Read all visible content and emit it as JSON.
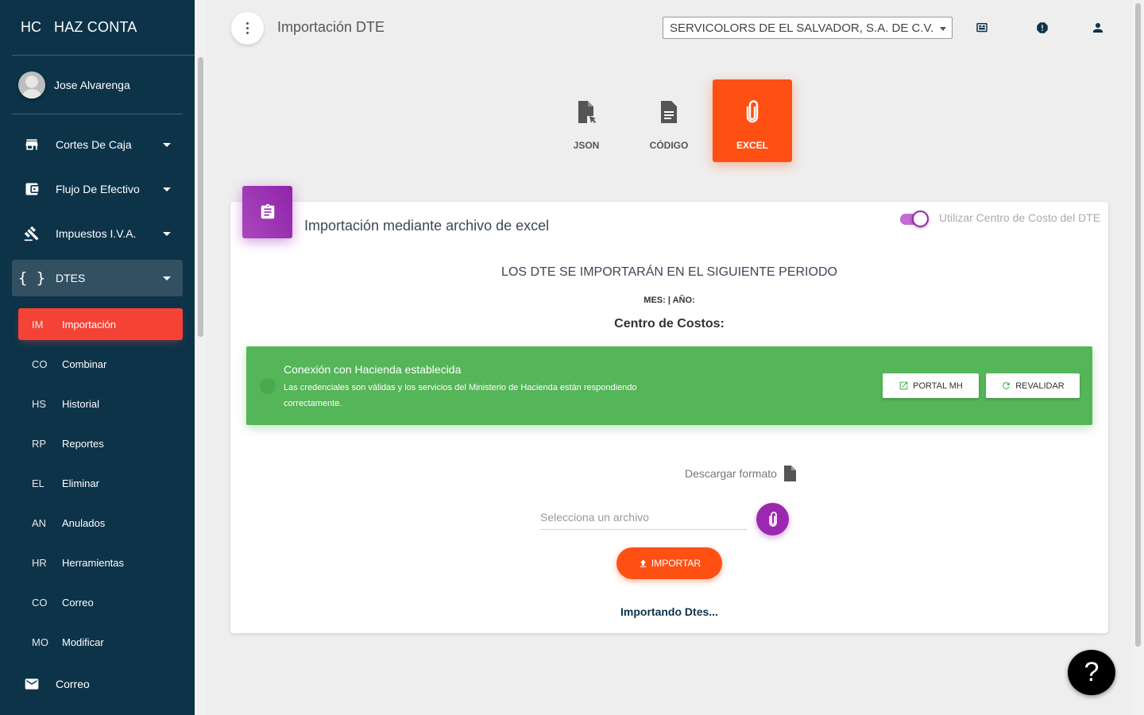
{
  "app": {
    "mini": "HC",
    "name": "HAZ CONTA"
  },
  "user": {
    "name": "Jose Alvarenga"
  },
  "nav": {
    "items": [
      {
        "label": "Cortes De Caja",
        "icon": "store-icon"
      },
      {
        "label": "Flujo De Efectivo",
        "icon": "wallet-icon"
      },
      {
        "label": "Impuestos I.V.A.",
        "icon": "gavel-icon"
      },
      {
        "label": "DTES",
        "icon": "code-braces-icon"
      }
    ],
    "sub_items": [
      {
        "mini": "IM",
        "label": "Importación",
        "active": true
      },
      {
        "mini": "CO",
        "label": "Combinar"
      },
      {
        "mini": "HS",
        "label": "Historial"
      },
      {
        "mini": "RP",
        "label": "Reportes"
      },
      {
        "mini": "EL",
        "label": "Eliminar"
      },
      {
        "mini": "AN",
        "label": "Anulados"
      },
      {
        "mini": "HR",
        "label": "Herramientas"
      },
      {
        "mini": "CO",
        "label": "Correo"
      },
      {
        "mini": "MO",
        "label": "Modificar"
      }
    ],
    "mail": {
      "label": "Correo",
      "icon": "mail-icon"
    }
  },
  "topbar": {
    "title": "Importación DTE",
    "company": "SERVICOLORS DE EL SALVADOR, S.A. DE C.V."
  },
  "tabs": [
    {
      "label": "JSON",
      "icon": "file-json-icon"
    },
    {
      "label": "CÓDIGO",
      "icon": "document-icon"
    },
    {
      "label": "EXCEL",
      "icon": "paperclip-icon",
      "active": true
    }
  ],
  "card": {
    "title": "Importación mediante archivo de excel",
    "toggle_label": "Utilizar Centro de Costo del DTE",
    "toggle_on": true,
    "period_title": "LOS DTE SE IMPORTARÁN EN EL SIGUIENTE PERIODO",
    "mes_anio": "MES: | AÑO:",
    "centro": "Centro de Costos:"
  },
  "alert": {
    "title": "Conexión con Hacienda establecida",
    "text": "Las credenciales son válidas y los servicios del Ministerio de Hacienda están respondiendo correctamente.",
    "portal_btn": "PORTAL MH",
    "revalidar_btn": "REVALIDAR",
    "color": "#55b559"
  },
  "upload": {
    "download_label": "Descargar formato",
    "file_placeholder": "Selecciona un archivo",
    "import_btn": "IMPORTAR",
    "status": "Importando Dtes..."
  },
  "help": {
    "label": "?"
  },
  "colors": {
    "sidebar": "#0d3349",
    "active": "#f44336",
    "accent": "#ff5014",
    "purple": "#9c27b0"
  }
}
